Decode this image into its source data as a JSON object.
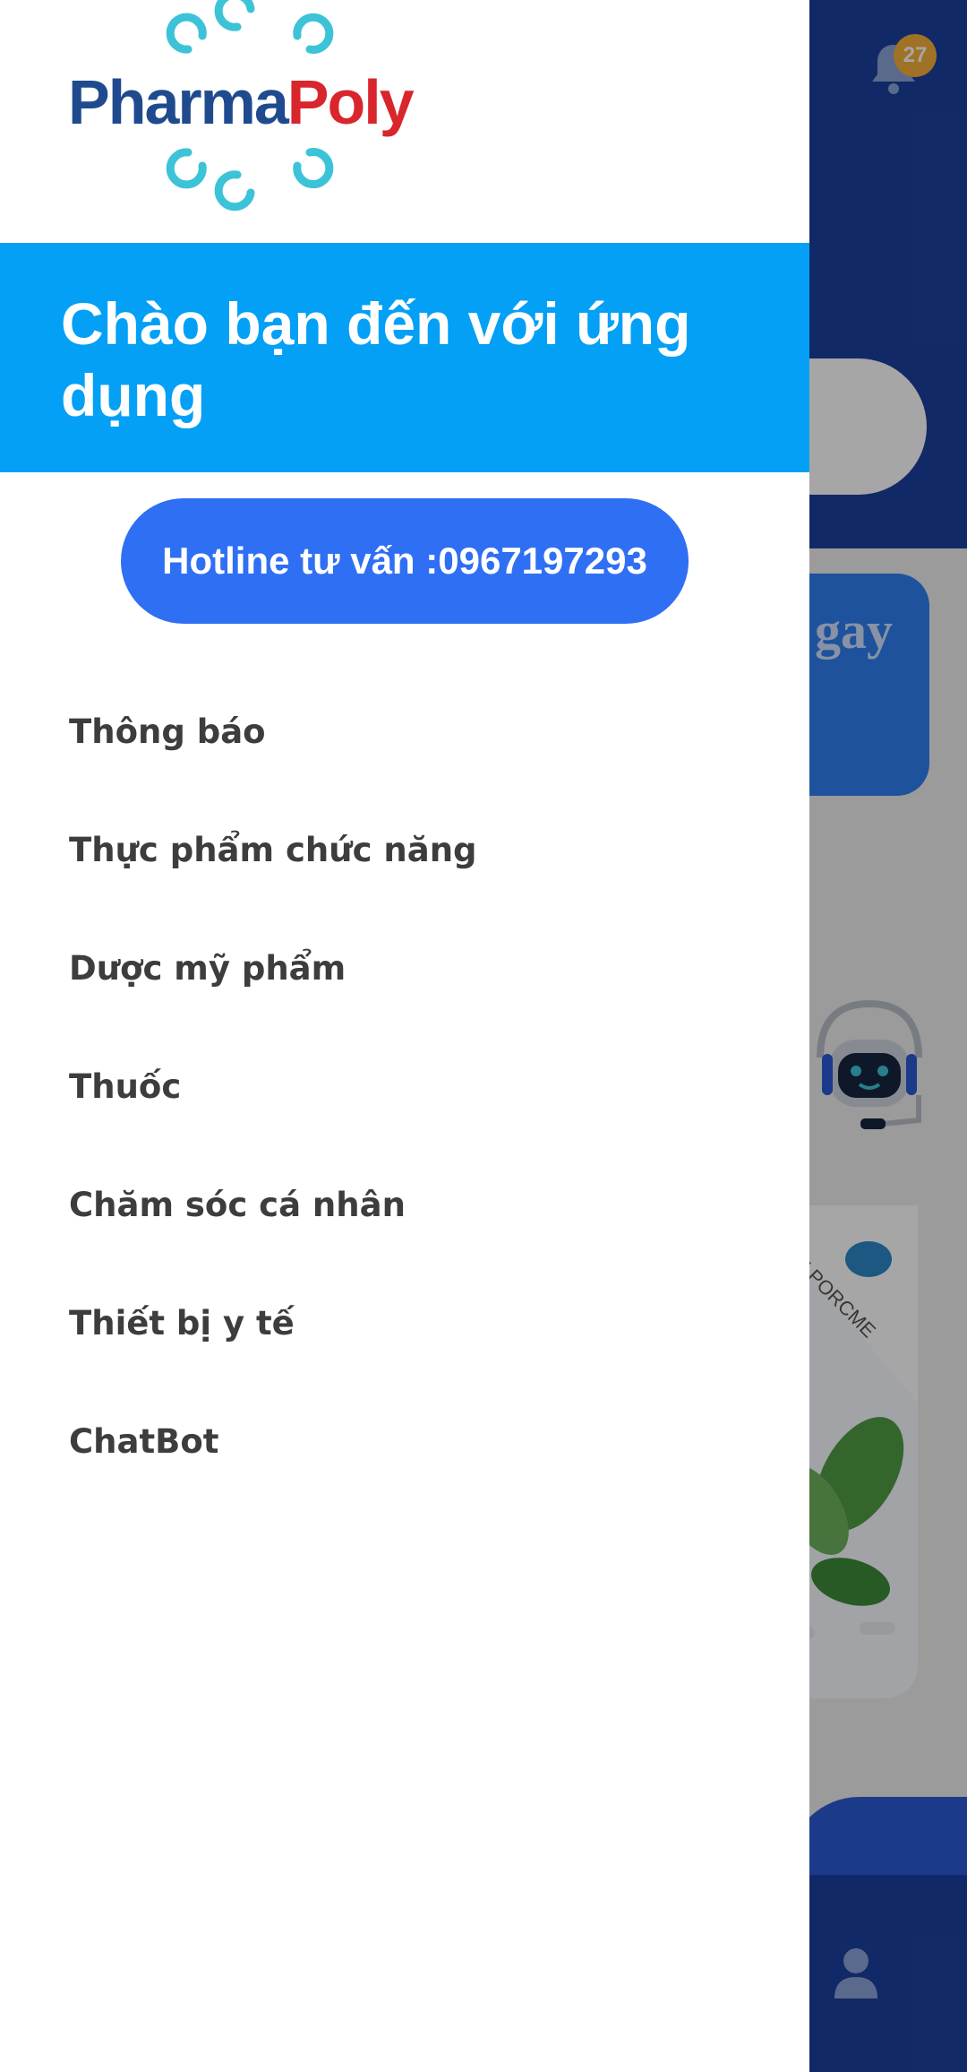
{
  "background": {
    "notification_count": "27",
    "banner_text": "gay",
    "product_label": "E PORCME",
    "icons": [
      "bell-icon",
      "chatbot-icon",
      "user-icon"
    ]
  },
  "drawer": {
    "logo": {
      "part1": "Pharma",
      "part2": "Poly"
    },
    "welcome_title": "Chào bạn đến với ứng dụng",
    "hotline_label": "Hotline tư vấn :0967197293",
    "menu_items": [
      {
        "label": "Thông báo"
      },
      {
        "label": "Thực phẩm chức năng"
      },
      {
        "label": "Dược mỹ phẩm"
      },
      {
        "label": "Thuốc"
      },
      {
        "label": "Chăm sóc cá nhân"
      },
      {
        "label": "Thiết bị y tế"
      },
      {
        "label": "ChatBot"
      }
    ]
  },
  "colors": {
    "header_blue": "#03a0f5",
    "button_blue": "#2f6ff4",
    "logo_dark": "#1f4b8e",
    "logo_red": "#d8262c",
    "logo_teal": "#3cc3d8"
  }
}
